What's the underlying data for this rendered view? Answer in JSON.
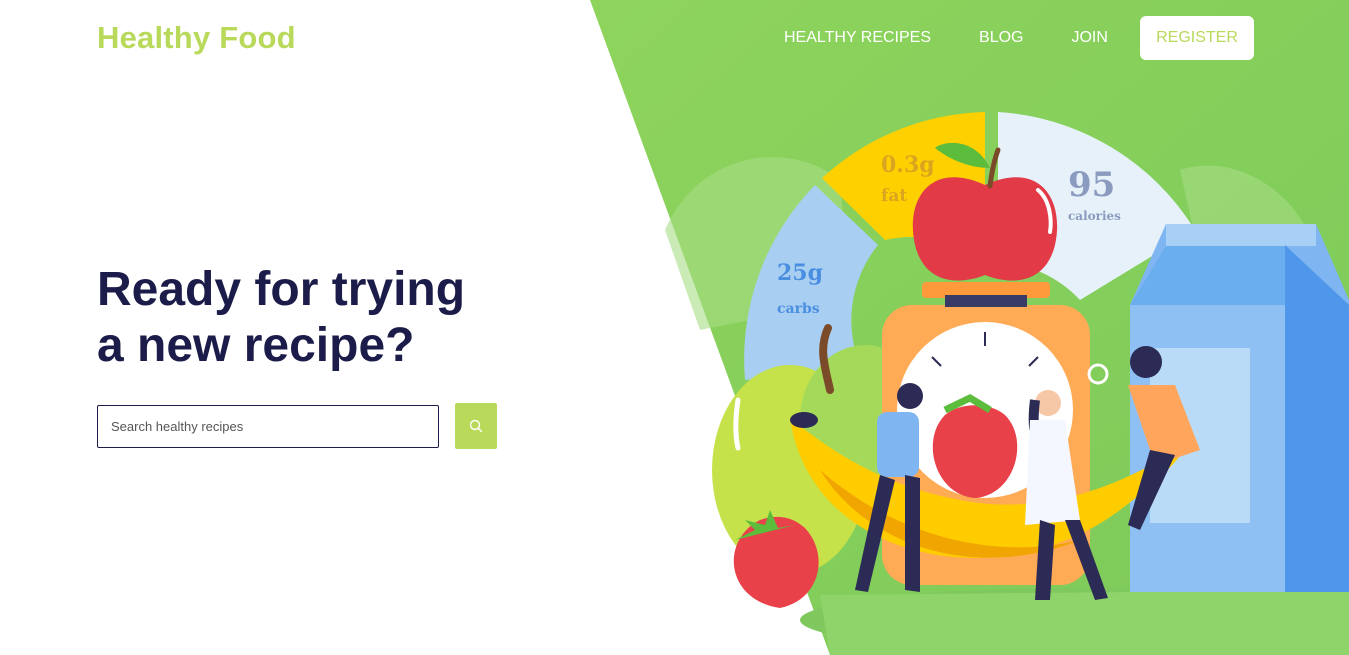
{
  "brand": {
    "name": "Healthy Food"
  },
  "nav": {
    "items": [
      {
        "label": "HEALTHY RECIPES"
      },
      {
        "label": "BLOG"
      },
      {
        "label": "JOIN"
      }
    ],
    "register_label": "REGISTER"
  },
  "hero": {
    "headline_line1": "Ready for trying",
    "headline_line2": "a new recipe?",
    "search": {
      "placeholder": "Search healthy recipes",
      "value": ""
    },
    "search_button_icon": "search-icon"
  },
  "nutrition": {
    "fat": {
      "value": "0.3g",
      "label": "fat"
    },
    "calories": {
      "value": "95",
      "label": "calories"
    },
    "carbs": {
      "value": "25g",
      "label": "carbs"
    }
  },
  "colors": {
    "brand_green": "#b8d95a",
    "hero_green": "#8cd05f",
    "headline_navy": "#1c1c4a"
  }
}
